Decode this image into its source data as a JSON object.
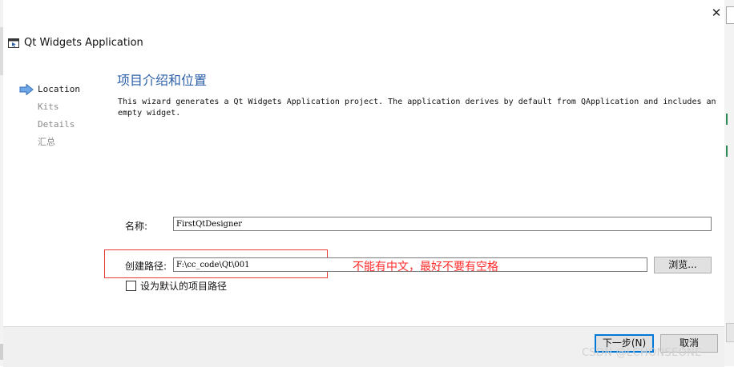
{
  "window": {
    "title": "Qt Widgets Application"
  },
  "steps": [
    {
      "label": "Location",
      "active": true
    },
    {
      "label": "Kits",
      "active": false
    },
    {
      "label": "Details",
      "active": false
    },
    {
      "label": "汇总",
      "active": false
    }
  ],
  "page": {
    "title": "项目介绍和位置",
    "description": "This wizard generates a Qt Widgets Application project. The application derives by default from QApplication and includes an empty widget."
  },
  "form": {
    "name_label": "名称:",
    "name_value": "FirstQtDesigner",
    "path_label": "创建路径:",
    "path_value": "F:\\cc_code\\Qt\\001",
    "browse_label": "浏览...",
    "default_path_label": "设为默认的项目路径",
    "default_path_checked": false
  },
  "annotation": {
    "text": "不能有中文，最好不要有空格",
    "color": "#ff2b2b"
  },
  "footer": {
    "next_label": "下一步(N)",
    "cancel_label": "取消"
  },
  "watermark": "CSDN @LCHONSEONE",
  "colors": {
    "title_blue": "#2b5fa8",
    "accent": "#0078d7"
  },
  "icons": [
    "close-icon",
    "app-window-icon",
    "arrow-right-icon",
    "checkbox-icon"
  ]
}
